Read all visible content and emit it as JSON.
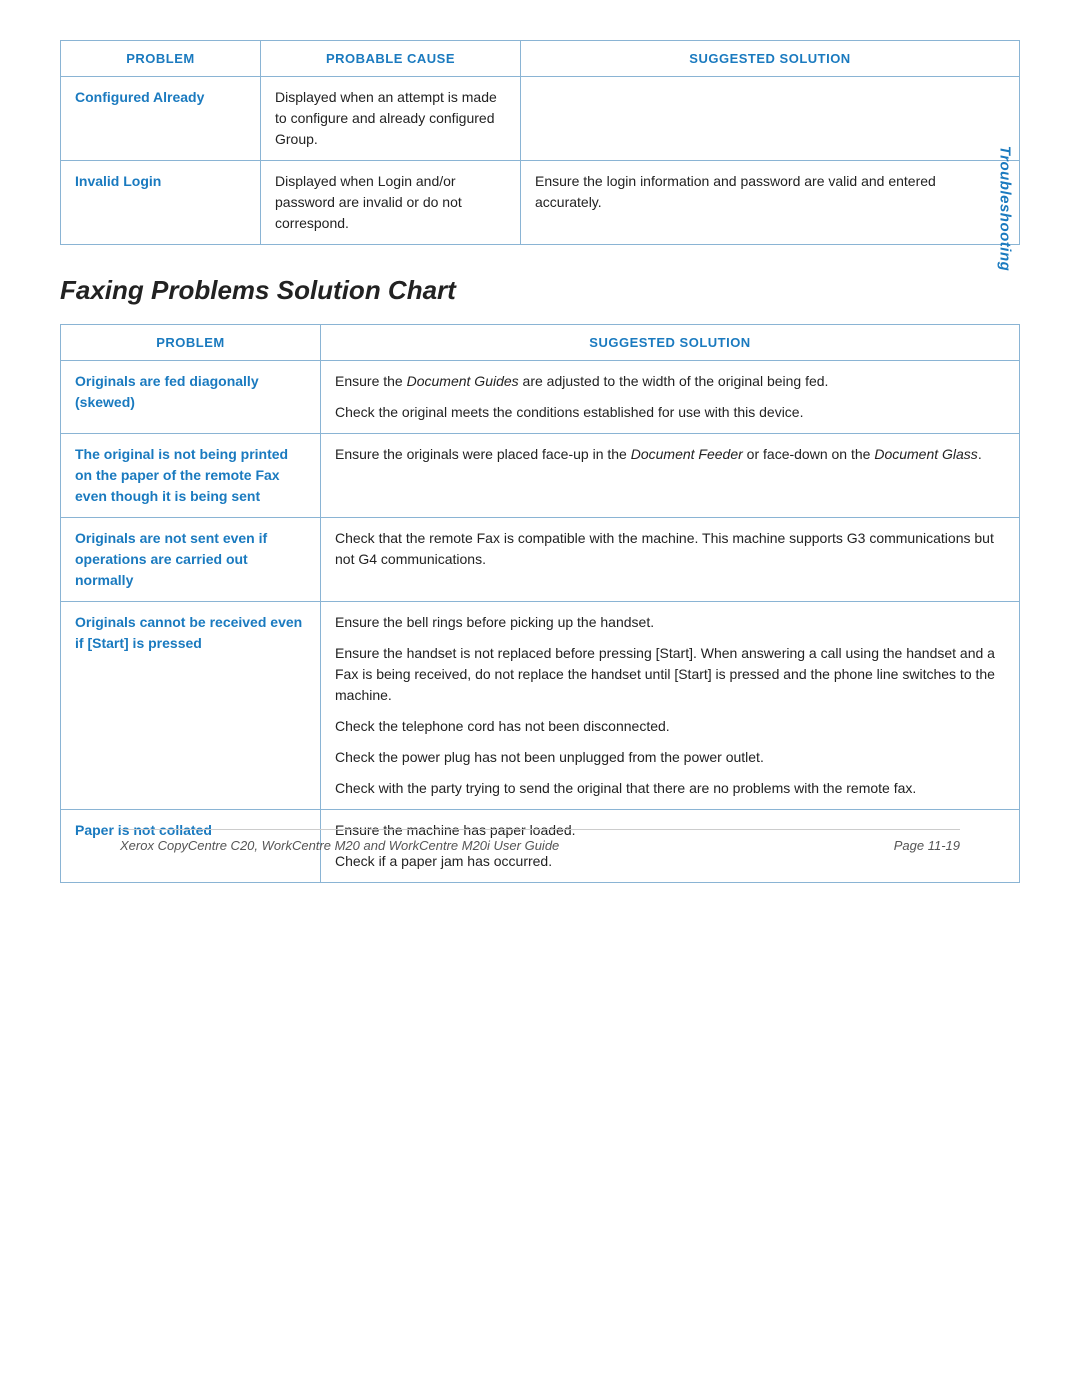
{
  "sidebar": {
    "label": "Troubleshooting"
  },
  "top_table": {
    "headers": [
      "PROBLEM",
      "PROBABLE CAUSE",
      "SUGGESTED SOLUTION"
    ],
    "rows": [
      {
        "problem": "Configured Already",
        "cause": "Displayed when an attempt is made to configure and already configured Group.",
        "solution": ""
      },
      {
        "problem": "Invalid Login",
        "cause": "Displayed when Login and/or password are invalid or do not correspond.",
        "solution": "Ensure the login information and password are valid and entered accurately."
      }
    ]
  },
  "section_title": "Faxing Problems Solution Chart",
  "fax_table": {
    "headers": [
      "PROBLEM",
      "SUGGESTED SOLUTION"
    ],
    "rows": [
      {
        "problem": "Originals are fed diagonally (skewed)",
        "solutions": [
          "Ensure the <em>Document Guides</em> are adjusted to the width of the original being fed.",
          "Check the original meets the conditions established for use with this device."
        ]
      },
      {
        "problem": "The original is not being printed on the paper of the remote Fax even though it is being sent",
        "solutions": [
          "Ensure the originals were placed face-up in the <em>Document Feeder</em> or face-down on the <em>Document Glass</em>."
        ]
      },
      {
        "problem": "Originals are not sent even if operations are carried out normally",
        "solutions": [
          "Check that the remote Fax is compatible with the machine. This machine supports G3 communications but not G4 communications."
        ]
      },
      {
        "problem": "Originals cannot be received even if [Start] is pressed",
        "solutions": [
          "Ensure the bell rings before picking up the handset.",
          "Ensure the handset is not replaced before pressing [Start]. When answering a call using the handset and a Fax is being received, do not replace the handset until [Start] is pressed and the phone line switches to the machine.",
          "Check the telephone cord has not been disconnected.",
          "Check the power plug has not been unplugged from the power outlet.",
          "Check with the party trying to send the original that there are no problems with the remote fax."
        ]
      },
      {
        "problem": "Paper is not collated",
        "solutions": [
          "Ensure the machine has paper loaded.",
          "Check if a paper jam has occurred."
        ]
      }
    ]
  },
  "footer": {
    "left": "Xerox CopyCentre C20, WorkCentre M20 and WorkCentre M20i User Guide",
    "right": "Page 11-19"
  }
}
